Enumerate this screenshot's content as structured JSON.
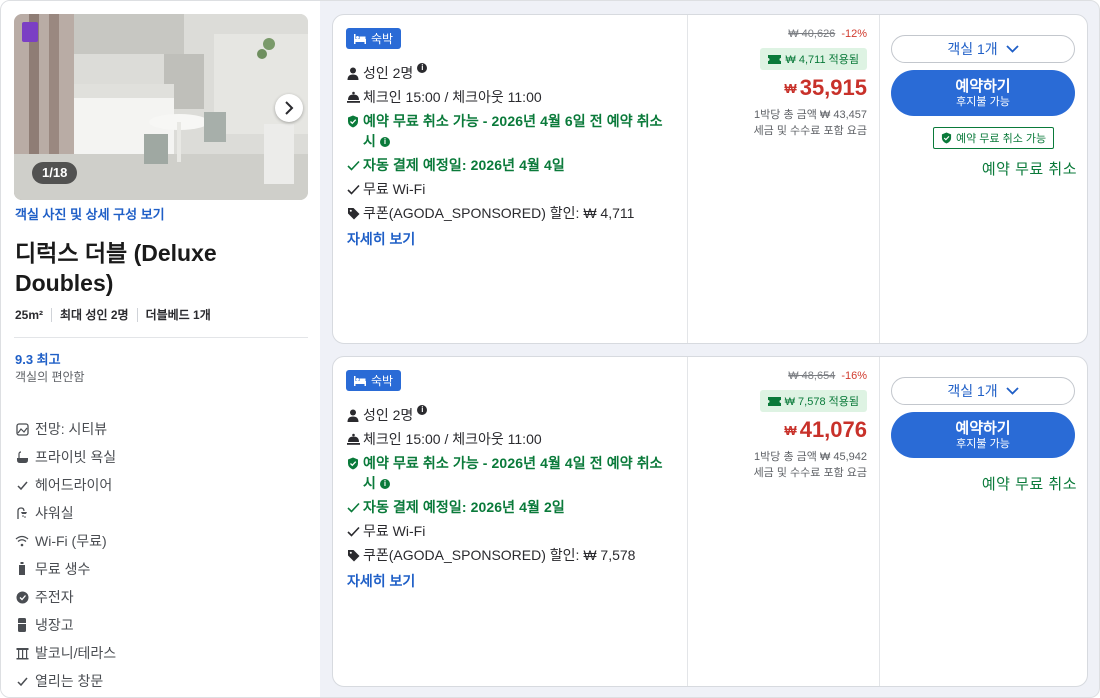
{
  "room": {
    "photo_counter": "1/18",
    "photo_link": "객실 사진 및 상세 구성 보기",
    "title": "디럭스 더블 (Deluxe Doubles)",
    "size": "25m²",
    "max_occupancy": "최대 성인 2명",
    "bed": "더블베드 1개",
    "rating": "9.3 최고",
    "rating_sub": "객실의 편안함",
    "amenities": [
      {
        "icon": "view-icon",
        "label": "전망: 시티뷰"
      },
      {
        "icon": "bathtub-icon",
        "label": "프라이빗 욕실"
      },
      {
        "icon": "check-icon",
        "label": "헤어드라이어"
      },
      {
        "icon": "shower-icon",
        "label": "샤워실"
      },
      {
        "icon": "wifi-icon",
        "label": "Wi-Fi (무료)"
      },
      {
        "icon": "water-bottle-icon",
        "label": "무료 생수"
      },
      {
        "icon": "kettle-icon",
        "label": "주전자"
      },
      {
        "icon": "fridge-icon",
        "label": "냉장고"
      },
      {
        "icon": "balcony-icon",
        "label": "발코니/테라스"
      },
      {
        "icon": "check-icon",
        "label": "열리는 창문"
      }
    ]
  },
  "offers": [
    {
      "badge": "숙박",
      "guests": "성인 2명",
      "checkin": "체크인 15:00 / 체크아웃 11:00",
      "cancel_policy": "예약 무료 취소 가능 - 2026년 4월 6일 전 예약 취소 시",
      "autopay": "자동 결제 예정일: 2026년 4월 4일",
      "wifi": "무료 Wi-Fi",
      "coupon": "쿠폰(AGODA_SPONSORED) 할인: ₩ 4,711",
      "details_link": "자세히 보기",
      "original_price": "₩ 40,626",
      "discount_pct": "-12%",
      "coupon_applied": "₩ 4,711 적용됨",
      "currency": "₩",
      "price": "35,915",
      "total_line": "1박당 총 금액 ₩ 43,457",
      "tax_line": "세금 및 수수료 포함 요금",
      "room_select": "객실 1개",
      "book_label": "예약하기",
      "book_sub": "후지불 가능",
      "cancel_badge": "예약 무료 취소 가능",
      "free_cancel": "예약 무료 취소"
    },
    {
      "badge": "숙박",
      "guests": "성인 2명",
      "checkin": "체크인 15:00 / 체크아웃 11:00",
      "cancel_policy": "예약 무료 취소 가능 - 2026년 4월 4일 전 예약 취소 시",
      "autopay": "자동 결제 예정일: 2026년 4월 2일",
      "wifi": "무료 Wi-Fi",
      "coupon": "쿠폰(AGODA_SPONSORED) 할인: ₩ 7,578",
      "details_link": "자세히 보기",
      "original_price": "₩ 48,654",
      "discount_pct": "-16%",
      "coupon_applied": "₩ 7,578 적용됨",
      "currency": "₩",
      "price": "41,076",
      "total_line": "1박당 총 금액 ₩ 45,942",
      "tax_line": "세금 및 수수료 포함 요금",
      "room_select": "객실 1개",
      "book_label": "예약하기",
      "book_sub": "후지불 가능",
      "free_cancel": "예약 무료 취소"
    }
  ],
  "colors": {
    "primary_blue": "#2a6bd6",
    "link_blue": "#1f5fc7",
    "green": "#0a7a3a",
    "price_red": "#c8312a"
  }
}
